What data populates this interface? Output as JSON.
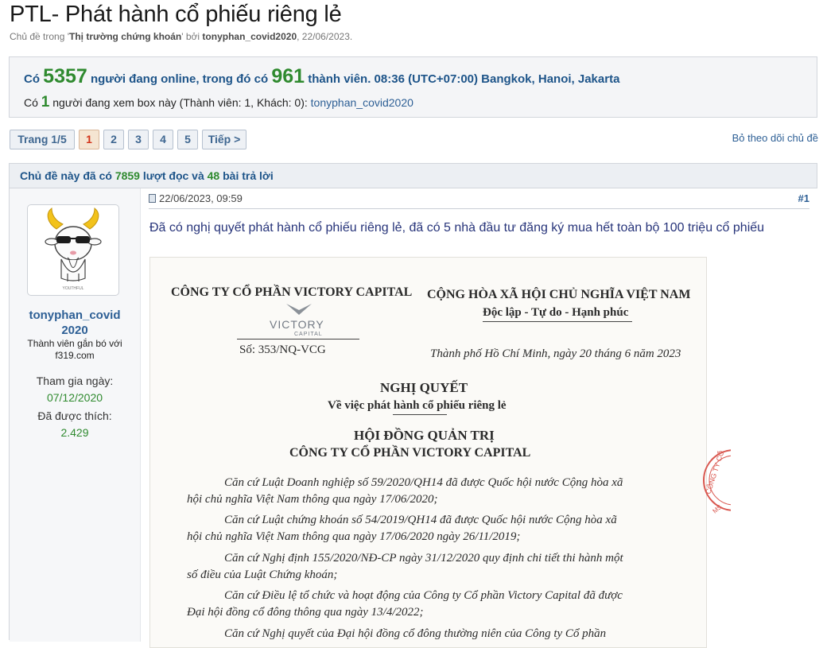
{
  "thread": {
    "title": "PTL- Phát hành cổ phiếu riêng lẻ",
    "meta_prefix": "Chủ đề trong '",
    "forum": "Thị trường chứng khoán",
    "meta_mid": "' bởi ",
    "author": "tonyphan_covid2020",
    "date": ", 22/06/2023."
  },
  "online": {
    "p1": "Có ",
    "total": "5357",
    "p2": " người đang online, trong đó có ",
    "members": "961",
    "p3": " thành viên. 08:36 (UTC+07:00) Bangkok, Hanoi, Jakarta",
    "v1": "Có ",
    "viewers": "1",
    "v2": " người đang xem box này (Thành viên: 1, Khách: 0): ",
    "viewer_name": "tonyphan_covid2020"
  },
  "pager": {
    "label": "Trang 1/5",
    "pages": [
      "1",
      "2",
      "3",
      "4",
      "5"
    ],
    "next": "Tiếp >"
  },
  "unwatch_label": "Bỏ theo dõi chủ đề",
  "thread_stats": {
    "p1": "Chủ đề này đã có ",
    "views": "7859",
    "p2": " lượt đọc và ",
    "replies": "48",
    "p3": " bài trả lời"
  },
  "post": {
    "datetime": "22/06/2023, 09:59",
    "number": "#1",
    "author_line1": "tonyphan_covid",
    "author_line2": "2020",
    "rank_line1": "Thành viên gắn bó với",
    "rank_line2": "f319.com",
    "join_label": "Tham gia ngày:",
    "join_date": "07/12/2020",
    "likes_label": "Đã được thích:",
    "likes": "2.429",
    "avatar_caption": "YOUTHFUL",
    "text": "Đã có nghị quyết phát hành cổ phiếu riêng lẻ, đã có 5 nhà đầu tư đăng ký mua hết toàn bộ 100 triệu cổ phiếu"
  },
  "document": {
    "company": "CÔNG TY CỔ PHẦN VICTORY CAPITAL",
    "logo_name": "VICTORY",
    "logo_sub": "CAPITAL",
    "number": "Số: 353/NQ-VCG",
    "nation": "CỘNG HÒA XÃ HỘI CHỦ NGHĨA VIỆT NAM",
    "motto": "Độc lập - Tự do - Hạnh phúc",
    "place_date": "Thành phố Hồ Chí Minh, ngày 20 tháng 6 năm 2023",
    "heading": "NGHỊ QUYẾT",
    "subheading": "Về việc phát hành cổ phiếu riêng lẻ",
    "board": "HỘI ĐỒNG QUẢN TRỊ",
    "board_company": "CÔNG TY CỔ PHẦN VICTORY CAPITAL",
    "lines": [
      "Căn cứ Luật Doanh nghiệp số 59/2020/QH14 đã được Quốc hội nước Cộng hòa xã",
      "hội chủ nghĩa Việt Nam thông qua ngày 17/06/2020;",
      "Căn cứ Luật chứng khoán số 54/2019/QH14 đã được Quốc hội nước Cộng hòa xã",
      "hội chủ nghĩa Việt Nam thông qua ngày 17/06/2020 ngày 26/11/2019;",
      "Căn cứ Nghị định 155/2020/NĐ-CP ngày 31/12/2020 quy định chi tiết thi hành một",
      "số điều của Luật Chứng khoán;",
      "Căn cứ Điều lệ tổ chức và hoạt động của Công ty Cổ phần Victory Capital đã được",
      "Đại hội đồng cổ đông thông qua ngày 13/4/2022;",
      "Căn cứ Nghị quyết của Đại hội đồng cổ đông thường niên của Công ty Cổ phần"
    ],
    "stamp_text": "CÔNG TY CỔ",
    "stamp_sub": "MS"
  },
  "colors": {
    "link_blue": "#2d5f95",
    "heading_blue": "#1d5489",
    "count_green": "#2f8a2f",
    "current_page": "#d2331a",
    "stamp_red": "#d9574f"
  }
}
